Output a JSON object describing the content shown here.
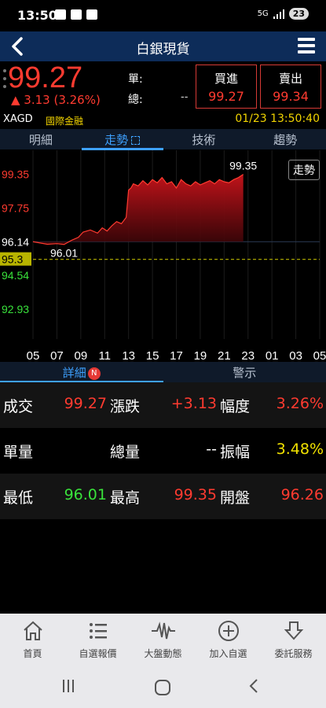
{
  "status": {
    "time": "13:50",
    "battery": "23",
    "network": "5G"
  },
  "header": {
    "title": "白銀現貨"
  },
  "quote": {
    "price": "99.27",
    "change": "▲ 3.13 (3.26%)",
    "single_label": "單:",
    "total_label": "總:",
    "total_value": "--",
    "buy_label": "買進",
    "buy_price": "99.27",
    "sell_label": "賣出",
    "sell_price": "99.34"
  },
  "info": {
    "code": "XAGD",
    "market": "國際金融",
    "datetime": "01/23 13:50:40"
  },
  "tabs": [
    {
      "label": "明細"
    },
    {
      "label": "走勢",
      "active": true
    },
    {
      "label": "技術"
    },
    {
      "label": "趨勢"
    }
  ],
  "chart_data": {
    "type": "area",
    "button_label": "走勢",
    "x_ticks": [
      "05",
      "07",
      "09",
      "11",
      "13",
      "15",
      "17",
      "19",
      "21",
      "23",
      "01",
      "03",
      "05"
    ],
    "y_labels": [
      "99.35",
      "97.75",
      "96.14",
      "95.3",
      "94.54",
      "92.93"
    ],
    "ylim": [
      91.5,
      100.5
    ],
    "reference_value": 95.3,
    "high_label": "99.35",
    "low_label": "96.01",
    "series": [
      {
        "x": [
          0.0,
          0.3,
          0.6,
          1.0,
          1.3,
          1.6,
          1.9,
          2.1,
          2.4,
          2.7,
          2.9,
          3.1,
          3.3,
          3.5,
          3.7,
          3.9,
          4.0,
          4.1,
          4.2,
          4.4,
          4.6,
          4.8,
          5.0,
          5.2,
          5.4,
          5.6,
          5.8,
          6.0,
          6.2,
          6.4,
          6.6,
          6.8,
          7.0,
          7.2,
          7.4,
          7.6,
          7.8,
          8.0,
          8.2,
          8.4,
          8.6,
          8.8
        ],
        "values": [
          96.14,
          96.08,
          96.02,
          96.05,
          96.01,
          96.2,
          96.35,
          96.6,
          96.7,
          96.55,
          96.8,
          96.65,
          96.9,
          97.1,
          97.0,
          97.3,
          98.6,
          98.7,
          98.9,
          98.8,
          99.05,
          98.85,
          99.1,
          98.95,
          99.2,
          98.9,
          99.0,
          98.7,
          99.1,
          98.9,
          98.8,
          99.0,
          98.85,
          98.95,
          99.05,
          98.9,
          99.1,
          99.0,
          98.95,
          99.1,
          99.2,
          99.35
        ]
      }
    ]
  },
  "detail_tabs": [
    {
      "label": "詳細",
      "badge": "N",
      "active": true
    },
    {
      "label": "警示"
    }
  ],
  "stats": {
    "r1": {
      "l1": "成交",
      "v1": "99.27",
      "l2": "漲跌",
      "v2": "+3.13",
      "l3": "幅度",
      "v3": "3.26%"
    },
    "r2": {
      "l1": "單量",
      "v1": "",
      "l2": "總量",
      "v2": "--",
      "l3": "振幅",
      "v3": "3.48%"
    },
    "r3": {
      "l1": "最低",
      "v1": "96.01",
      "l2": "最高",
      "v2": "99.35",
      "l3": "開盤",
      "v3": "96.26"
    }
  },
  "bottom_nav": [
    {
      "label": "首頁",
      "icon": "home-icon"
    },
    {
      "label": "自選報價",
      "icon": "list-icon"
    },
    {
      "label": "大盤動態",
      "icon": "pulse-icon"
    },
    {
      "label": "加入自選",
      "icon": "add-circle-icon"
    },
    {
      "label": "委託服務",
      "icon": "order-icon"
    }
  ]
}
